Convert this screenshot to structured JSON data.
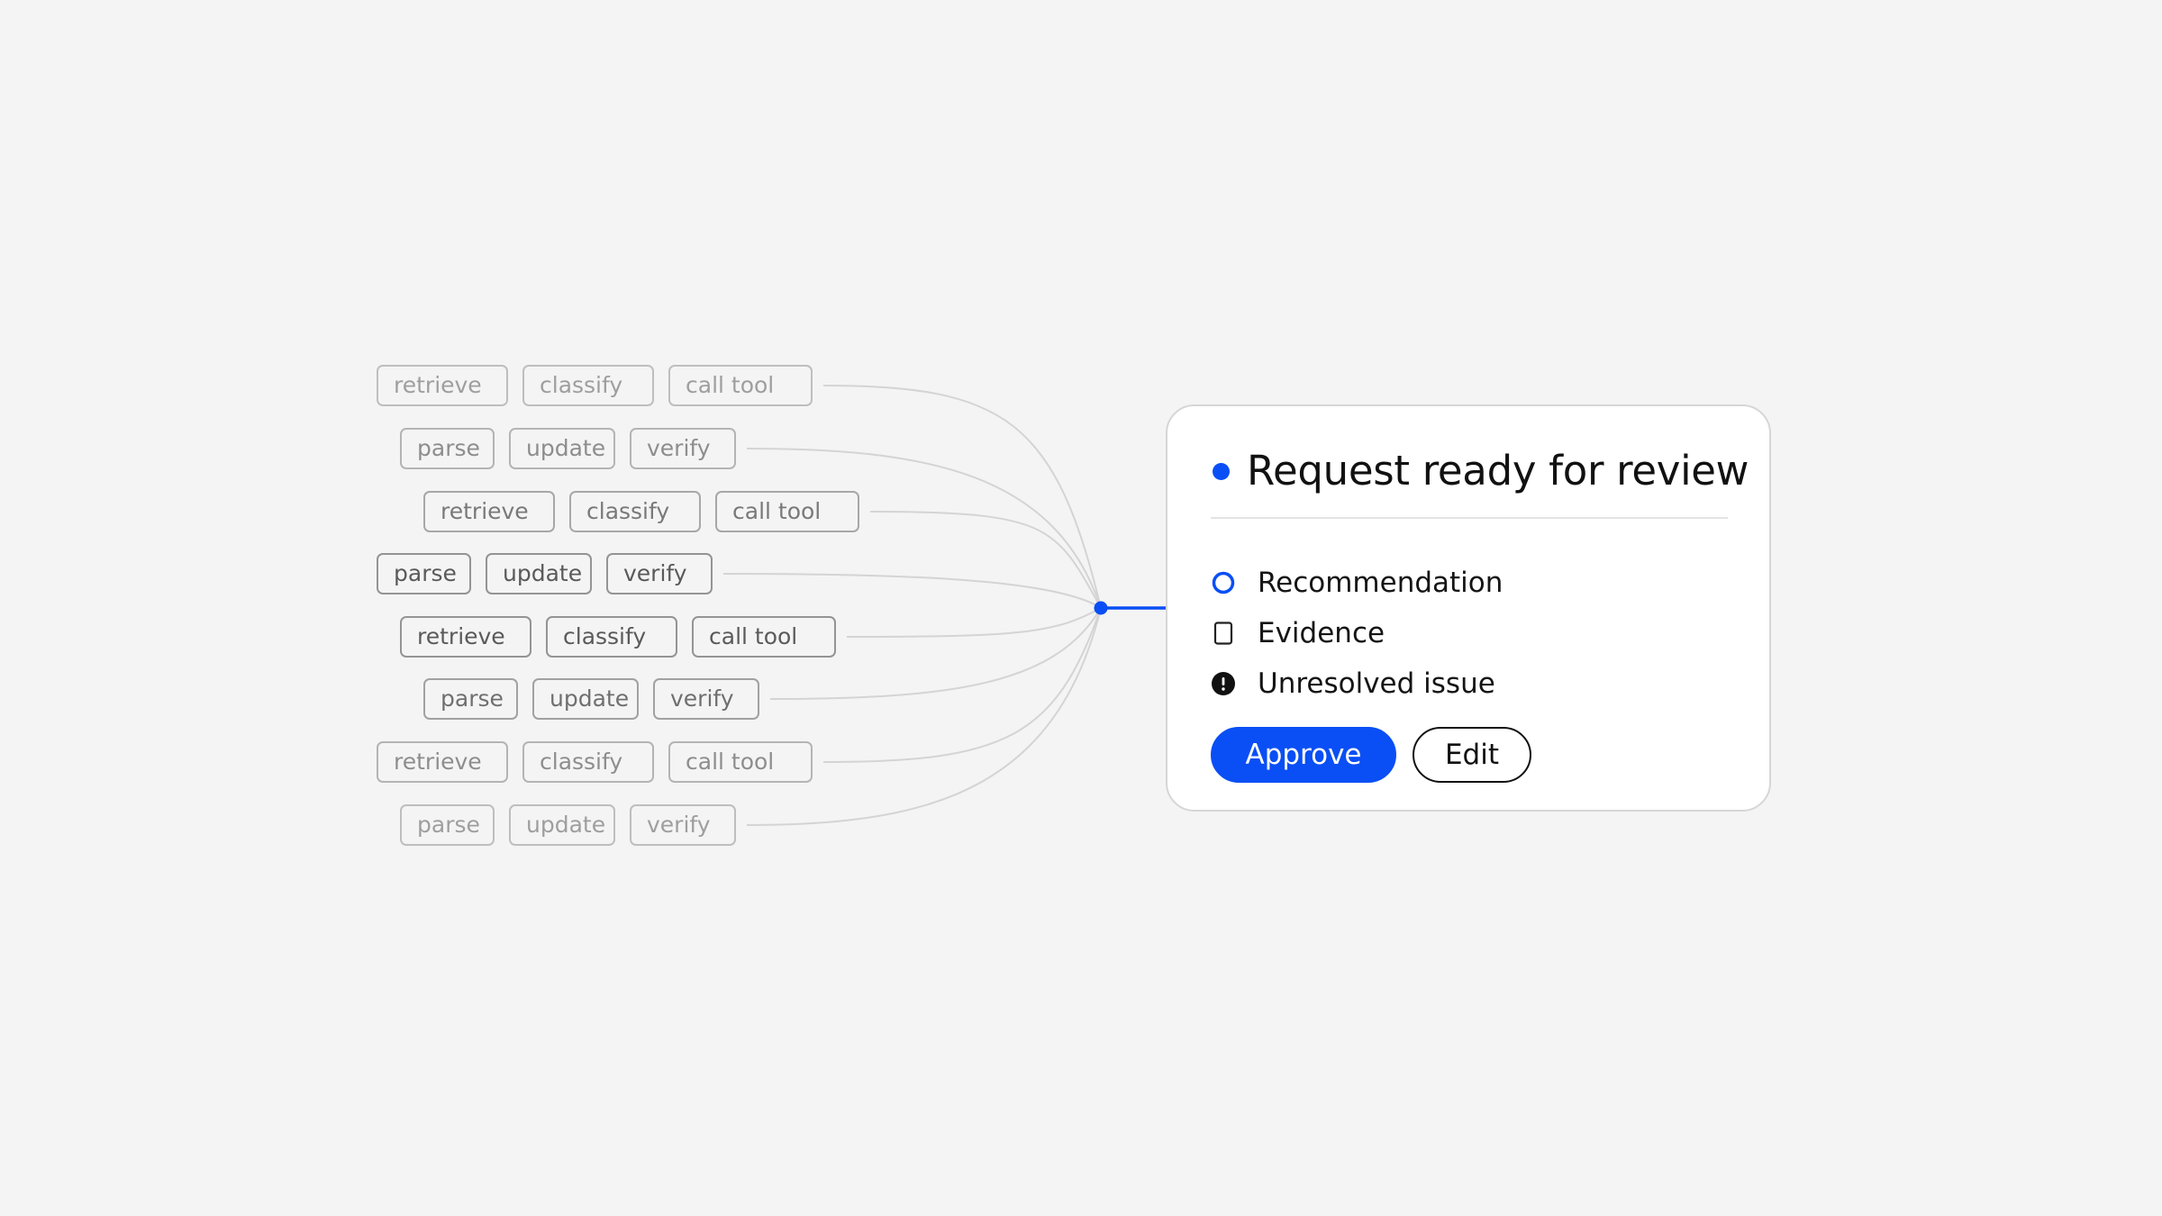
{
  "workflow": {
    "rows": [
      [
        "retrieve",
        "classify",
        "call tool"
      ],
      [
        "parse",
        "update",
        "verify"
      ],
      [
        "retrieve",
        "classify",
        "call tool"
      ],
      [
        "parse",
        "update",
        "verify"
      ],
      [
        "retrieve",
        "classify",
        "call tool"
      ],
      [
        "parse",
        "update",
        "verify"
      ],
      [
        "retrieve",
        "classify",
        "call tool"
      ],
      [
        "parse",
        "update",
        "verify"
      ]
    ]
  },
  "review_card": {
    "title": "Request ready for review",
    "checklist": [
      {
        "label": "Recommendation",
        "icon": "ring-icon"
      },
      {
        "label": "Evidence",
        "icon": "document-icon"
      },
      {
        "label": "Unresolved issue",
        "icon": "alert-icon"
      }
    ],
    "approve_label": "Approve",
    "edit_label": "Edit"
  },
  "colors": {
    "accent": "#0a4ff5",
    "background": "#f4f4f4",
    "card": "#ffffff",
    "connector": "#d4d4d4",
    "chip_border": "#8a8a8a",
    "text": "#111111"
  }
}
